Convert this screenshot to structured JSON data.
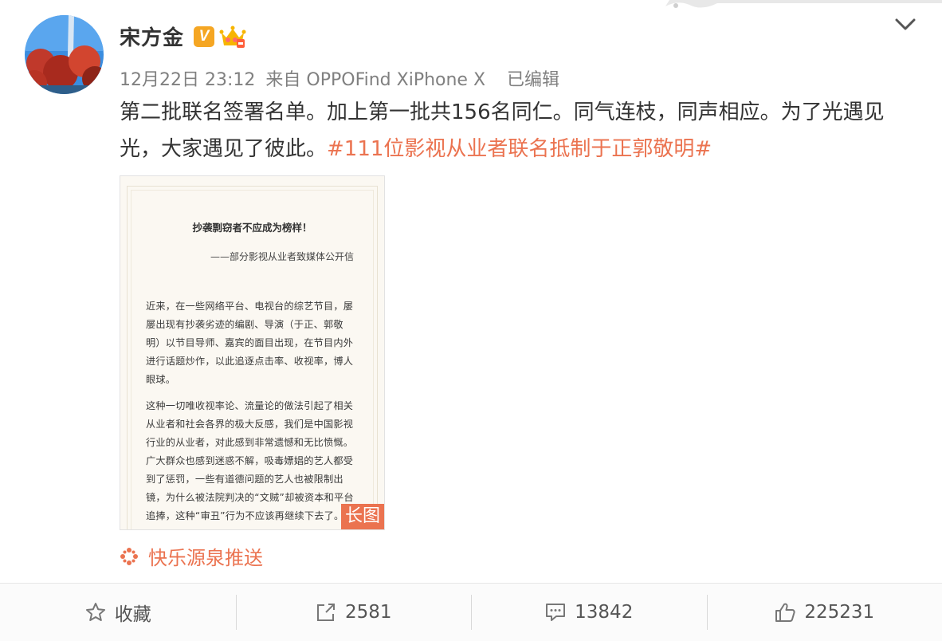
{
  "post": {
    "author": "宋方金",
    "time": "12月22日 23:12",
    "source_prefix": "来自",
    "source": "OPPOFind XiPhone X",
    "edited": "已编辑",
    "text": "第二批联名签署名单。加上第一批共156名同仁。同气连枝，同声相应。为了光遇见光，大家遇见了彼此。",
    "hashtag": "#111位影视从业者联名抵制于正郭敬明#",
    "push_label": "快乐源泉推送"
  },
  "image": {
    "title": "抄袭剽窃者不应成为榜样！",
    "subtitle": "——部分影视从业者致媒体公开信",
    "paragraph1": "近来，在一些网络平台、电视台的综艺节目，屡屡出现有抄袭劣迹的编剧、导演（于正、郭敬明）以节目导师、嘉宾的面目出现，在节目内外进行话题炒作，以此追逐点击率、收视率，博人眼球。",
    "paragraph2": "这种一切唯收视率论、流量论的做法引起了相关从业者和社会各界的极大反感，我们是中国影视行业的从业者，对此感到非常遗憾和无比愤慨。广大群众也感到迷惑不解，吸毒嫖娼的艺人都受到了惩罚，一些有道德问题的艺人也被限制出镜，为什么被法院判决的“文贼”却被资本和平台追捧，这种“审丑”行为不应该再继续下去了。",
    "badge": "长图"
  },
  "actions": {
    "favorite": "收藏",
    "repost_count": "2581",
    "comment_count": "13842",
    "like_count": "225231"
  },
  "colors": {
    "accent": "#eb7350",
    "verified": "#f5a623"
  }
}
